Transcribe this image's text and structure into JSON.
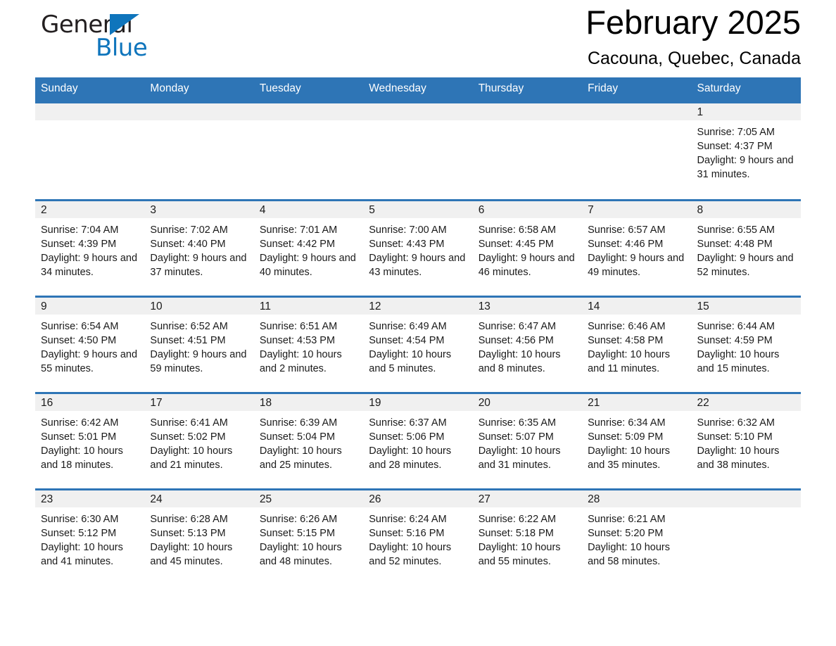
{
  "brand": {
    "name_part1": "General",
    "name_part2": "Blue",
    "logo_icon": "triangle-logo-icon"
  },
  "header": {
    "month_title": "February 2025",
    "location": "Cacouna, Quebec, Canada"
  },
  "colors": {
    "header_blue": "#2E75B6",
    "brand_blue": "#0f75bc",
    "date_band_gray": "#f0f0f0",
    "text": "#1a1a1a"
  },
  "calendar": {
    "day_headers": [
      "Sunday",
      "Monday",
      "Tuesday",
      "Wednesday",
      "Thursday",
      "Friday",
      "Saturday"
    ],
    "weeks": [
      [
        {
          "date": "",
          "empty": true
        },
        {
          "date": "",
          "empty": true
        },
        {
          "date": "",
          "empty": true
        },
        {
          "date": "",
          "empty": true
        },
        {
          "date": "",
          "empty": true
        },
        {
          "date": "",
          "empty": true
        },
        {
          "date": "1",
          "sunrise": "Sunrise: 7:05 AM",
          "sunset": "Sunset: 4:37 PM",
          "daylight": "Daylight: 9 hours and 31 minutes."
        }
      ],
      [
        {
          "date": "2",
          "sunrise": "Sunrise: 7:04 AM",
          "sunset": "Sunset: 4:39 PM",
          "daylight": "Daylight: 9 hours and 34 minutes."
        },
        {
          "date": "3",
          "sunrise": "Sunrise: 7:02 AM",
          "sunset": "Sunset: 4:40 PM",
          "daylight": "Daylight: 9 hours and 37 minutes."
        },
        {
          "date": "4",
          "sunrise": "Sunrise: 7:01 AM",
          "sunset": "Sunset: 4:42 PM",
          "daylight": "Daylight: 9 hours and 40 minutes."
        },
        {
          "date": "5",
          "sunrise": "Sunrise: 7:00 AM",
          "sunset": "Sunset: 4:43 PM",
          "daylight": "Daylight: 9 hours and 43 minutes."
        },
        {
          "date": "6",
          "sunrise": "Sunrise: 6:58 AM",
          "sunset": "Sunset: 4:45 PM",
          "daylight": "Daylight: 9 hours and 46 minutes."
        },
        {
          "date": "7",
          "sunrise": "Sunrise: 6:57 AM",
          "sunset": "Sunset: 4:46 PM",
          "daylight": "Daylight: 9 hours and 49 minutes."
        },
        {
          "date": "8",
          "sunrise": "Sunrise: 6:55 AM",
          "sunset": "Sunset: 4:48 PM",
          "daylight": "Daylight: 9 hours and 52 minutes."
        }
      ],
      [
        {
          "date": "9",
          "sunrise": "Sunrise: 6:54 AM",
          "sunset": "Sunset: 4:50 PM",
          "daylight": "Daylight: 9 hours and 55 minutes."
        },
        {
          "date": "10",
          "sunrise": "Sunrise: 6:52 AM",
          "sunset": "Sunset: 4:51 PM",
          "daylight": "Daylight: 9 hours and 59 minutes."
        },
        {
          "date": "11",
          "sunrise": "Sunrise: 6:51 AM",
          "sunset": "Sunset: 4:53 PM",
          "daylight": "Daylight: 10 hours and 2 minutes."
        },
        {
          "date": "12",
          "sunrise": "Sunrise: 6:49 AM",
          "sunset": "Sunset: 4:54 PM",
          "daylight": "Daylight: 10 hours and 5 minutes."
        },
        {
          "date": "13",
          "sunrise": "Sunrise: 6:47 AM",
          "sunset": "Sunset: 4:56 PM",
          "daylight": "Daylight: 10 hours and 8 minutes."
        },
        {
          "date": "14",
          "sunrise": "Sunrise: 6:46 AM",
          "sunset": "Sunset: 4:58 PM",
          "daylight": "Daylight: 10 hours and 11 minutes."
        },
        {
          "date": "15",
          "sunrise": "Sunrise: 6:44 AM",
          "sunset": "Sunset: 4:59 PM",
          "daylight": "Daylight: 10 hours and 15 minutes."
        }
      ],
      [
        {
          "date": "16",
          "sunrise": "Sunrise: 6:42 AM",
          "sunset": "Sunset: 5:01 PM",
          "daylight": "Daylight: 10 hours and 18 minutes."
        },
        {
          "date": "17",
          "sunrise": "Sunrise: 6:41 AM",
          "sunset": "Sunset: 5:02 PM",
          "daylight": "Daylight: 10 hours and 21 minutes."
        },
        {
          "date": "18",
          "sunrise": "Sunrise: 6:39 AM",
          "sunset": "Sunset: 5:04 PM",
          "daylight": "Daylight: 10 hours and 25 minutes."
        },
        {
          "date": "19",
          "sunrise": "Sunrise: 6:37 AM",
          "sunset": "Sunset: 5:06 PM",
          "daylight": "Daylight: 10 hours and 28 minutes."
        },
        {
          "date": "20",
          "sunrise": "Sunrise: 6:35 AM",
          "sunset": "Sunset: 5:07 PM",
          "daylight": "Daylight: 10 hours and 31 minutes."
        },
        {
          "date": "21",
          "sunrise": "Sunrise: 6:34 AM",
          "sunset": "Sunset: 5:09 PM",
          "daylight": "Daylight: 10 hours and 35 minutes."
        },
        {
          "date": "22",
          "sunrise": "Sunrise: 6:32 AM",
          "sunset": "Sunset: 5:10 PM",
          "daylight": "Daylight: 10 hours and 38 minutes."
        }
      ],
      [
        {
          "date": "23",
          "sunrise": "Sunrise: 6:30 AM",
          "sunset": "Sunset: 5:12 PM",
          "daylight": "Daylight: 10 hours and 41 minutes."
        },
        {
          "date": "24",
          "sunrise": "Sunrise: 6:28 AM",
          "sunset": "Sunset: 5:13 PM",
          "daylight": "Daylight: 10 hours and 45 minutes."
        },
        {
          "date": "25",
          "sunrise": "Sunrise: 6:26 AM",
          "sunset": "Sunset: 5:15 PM",
          "daylight": "Daylight: 10 hours and 48 minutes."
        },
        {
          "date": "26",
          "sunrise": "Sunrise: 6:24 AM",
          "sunset": "Sunset: 5:16 PM",
          "daylight": "Daylight: 10 hours and 52 minutes."
        },
        {
          "date": "27",
          "sunrise": "Sunrise: 6:22 AM",
          "sunset": "Sunset: 5:18 PM",
          "daylight": "Daylight: 10 hours and 55 minutes."
        },
        {
          "date": "28",
          "sunrise": "Sunrise: 6:21 AM",
          "sunset": "Sunset: 5:20 PM",
          "daylight": "Daylight: 10 hours and 58 minutes."
        },
        {
          "date": "",
          "empty": true
        }
      ]
    ]
  }
}
